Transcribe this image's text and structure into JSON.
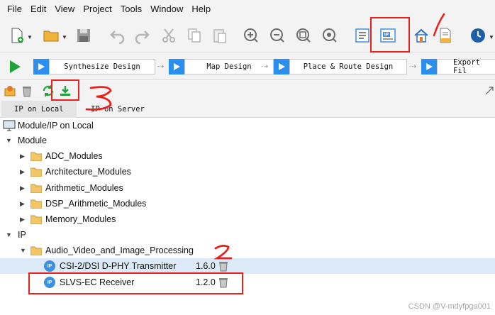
{
  "menu": [
    "File",
    "Edit",
    "View",
    "Project",
    "Tools",
    "Window",
    "Help"
  ],
  "toolbar": {
    "icons": [
      "new-file-icon",
      "open-folder-icon",
      "save-icon",
      "undo-icon",
      "redo-icon",
      "cut-icon",
      "copy-icon",
      "paste-icon",
      "zoom-in-icon",
      "zoom-out-icon",
      "zoom-fit-icon",
      "zoom-reset-icon",
      "report-icon",
      "ip-catalog-icon",
      "home-icon",
      "document-icon",
      "clock-icon"
    ]
  },
  "flow": {
    "steps": [
      "Synthesize Design",
      "Map Design",
      "Place & Route Design",
      "Export Fil"
    ]
  },
  "tabs": [
    "IP on Local",
    "IP on Server"
  ],
  "tree": {
    "root_label": "Module/IP on Local",
    "module_label": "Module",
    "modules": [
      "ADC_Modules",
      "Architecture_Modules",
      "Arithmetic_Modules",
      "DSP_Arithmetic_Modules",
      "Memory_Modules"
    ],
    "ip_label": "IP",
    "ip_group": "Audio_Video_and_Image_Processing",
    "ip_items": [
      {
        "badge": "IP",
        "name": "CSI-2/DSI D-PHY Transmitter",
        "version": "1.6.0"
      },
      {
        "badge": "IP",
        "name": "SLVS-EC Receiver",
        "version": "1.2.0"
      }
    ]
  },
  "annotations": {
    "mark_1": "1",
    "mark_2": "2",
    "mark_3": "3"
  },
  "watermark": "CSDN @V-mdyfpga001",
  "colors": {
    "accent": "#2b8ff0",
    "annotation": "#e8211d",
    "run": "#22a33a"
  }
}
